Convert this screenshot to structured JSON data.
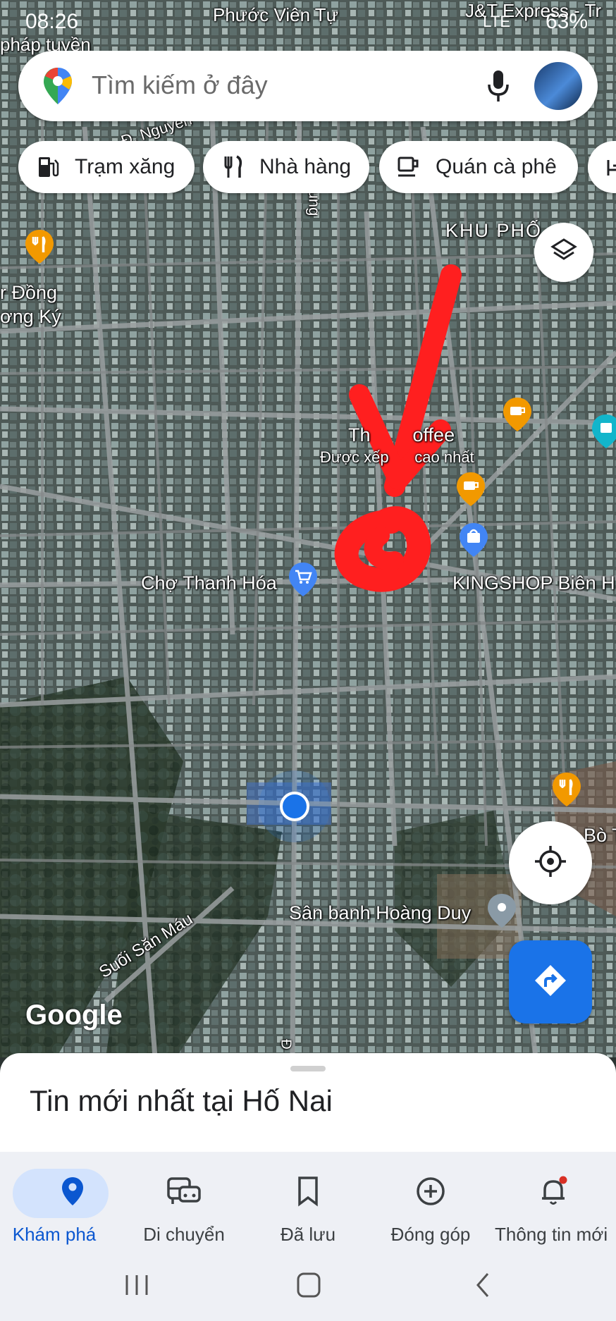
{
  "status_bar": {
    "time": "08:26",
    "battery": "63%",
    "network": "LTE"
  },
  "search": {
    "placeholder": "Tìm kiếm ở đây"
  },
  "chips": [
    {
      "label": "Trạm xăng",
      "icon": "gas-station-icon"
    },
    {
      "label": "Nhà hàng",
      "icon": "restaurant-icon"
    },
    {
      "label": "Quán cà phê",
      "icon": "cafe-icon"
    }
  ],
  "map_labels": {
    "phuoc_vien_tu": "Phước Viên Tự",
    "jt_express": "J&T Express - Tr",
    "phap_tuyen": "pháp tuyền",
    "nguyen": "Đ. Nguyễn",
    "tran_trung": "Trần Trung",
    "khu_pho": "KHU PHỐ",
    "dong": "r Đồng",
    "ky": "ơng Ký",
    "coffee": "Th        offee",
    "coffee_sub": "Được xếp      cao nhất",
    "cho_thanh_hoa": "Chợ Thanh Hóa",
    "kingshop": "KINGSHOP Biên H",
    "bo": "Bò T",
    "san_banh": "Sân banh Hoàng Duy",
    "suoi": "Suối Săn Máu",
    "road_d": "Đ",
    "google": "Google"
  },
  "sheet": {
    "title": "Tin mới nhất tại Hố Nai"
  },
  "bottom_nav": [
    {
      "label": "Khám phá",
      "icon": "explore-pin-icon",
      "active": true
    },
    {
      "label": "Di chuyển",
      "icon": "commute-icon",
      "active": false
    },
    {
      "label": "Đã lưu",
      "icon": "bookmark-icon",
      "active": false
    },
    {
      "label": "Đóng góp",
      "icon": "contribute-icon",
      "active": false
    },
    {
      "label": "Thông tin mới",
      "icon": "notification-bell-icon",
      "active": false
    }
  ],
  "colors": {
    "accent": "#1a73e8",
    "poi_orange": "#f29900",
    "poi_blue": "#4285f4",
    "annotation_red": "#ff1f1f"
  }
}
